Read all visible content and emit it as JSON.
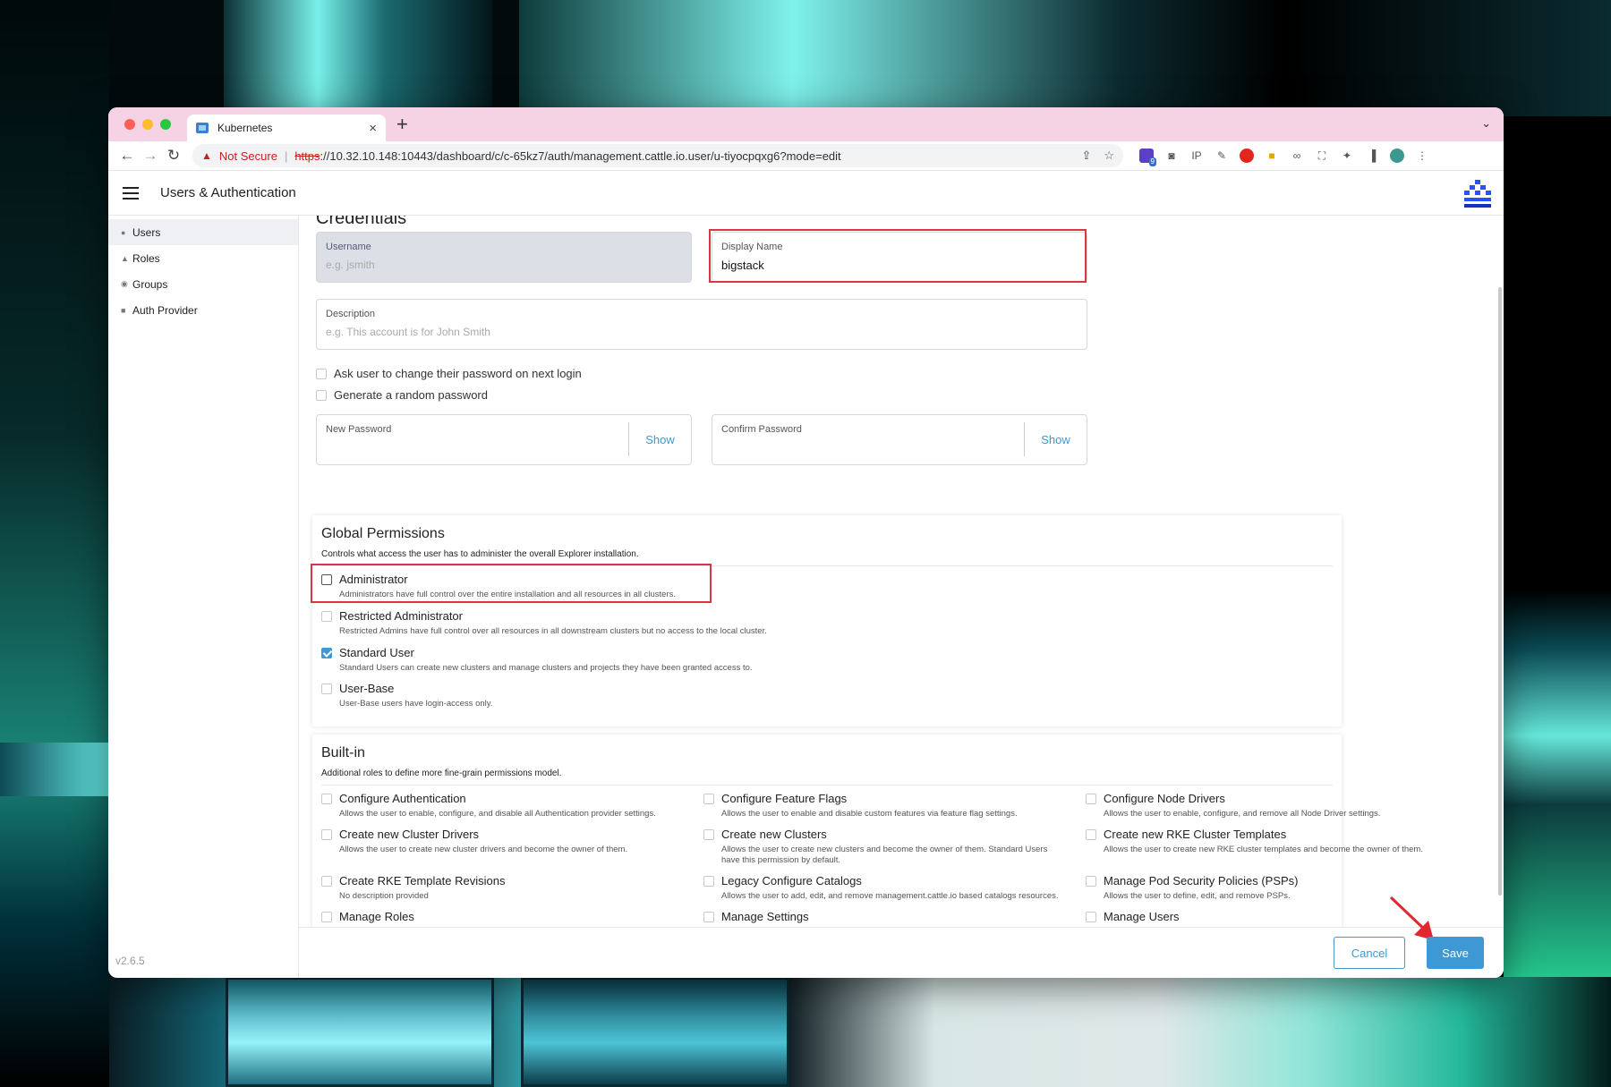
{
  "browser": {
    "tab_title": "Kubernetes",
    "security_label": "Not Secure",
    "url_scheme": "https",
    "url_rest": "://10.32.10.148:10443/dashboard/c/c-65kz7/auth/management.cattle.io.user/u-tiyocpqxg6?mode=edit",
    "extension_badge": "9"
  },
  "app": {
    "title": "Users & Authentication",
    "version": "v2.6.5"
  },
  "sidebar": {
    "items": [
      {
        "label": "Users",
        "icon": "user-icon"
      },
      {
        "label": "Roles",
        "icon": "role-icon"
      },
      {
        "label": "Groups",
        "icon": "group-icon"
      },
      {
        "label": "Auth Provider",
        "icon": "lock-icon"
      }
    ]
  },
  "credentials": {
    "section_title": "Credentials",
    "username_label": "Username",
    "username_placeholder": "e.g. jsmith",
    "display_name_label": "Display Name",
    "display_name_value": "bigstack",
    "description_label": "Description",
    "description_placeholder": "e.g. This account is for John Smith",
    "change_password_label": "Ask user to change their password on next login",
    "random_password_label": "Generate a random password",
    "new_password_label": "New Password",
    "confirm_password_label": "Confirm Password",
    "show_label": "Show"
  },
  "global_permissions": {
    "title": "Global Permissions",
    "description": "Controls what access the user has to administer the overall Explorer installation.",
    "items": [
      {
        "label": "Administrator",
        "desc": "Administrators have full control over the entire installation and all resources in all clusters.",
        "checked": false
      },
      {
        "label": "Restricted Administrator",
        "desc": "Restricted Admins have full control over all resources in all downstream clusters but no access to the local cluster.",
        "checked": false
      },
      {
        "label": "Standard User",
        "desc": "Standard Users can create new clusters and manage clusters and projects they have been granted access to.",
        "checked": true
      },
      {
        "label": "User-Base",
        "desc": "User-Base users have login-access only.",
        "checked": false
      }
    ]
  },
  "builtin": {
    "title": "Built-in",
    "description": "Additional roles to define more fine-grain permissions model.",
    "items": [
      {
        "label": "Configure Authentication",
        "desc": "Allows the user to enable, configure, and disable all Authentication provider settings."
      },
      {
        "label": "Configure Feature Flags",
        "desc": "Allows the user to enable and disable custom features via feature flag settings."
      },
      {
        "label": "Configure Node Drivers",
        "desc": "Allows the user to enable, configure, and remove all Node Driver settings."
      },
      {
        "label": "Create new Cluster Drivers",
        "desc": "Allows the user to create new cluster drivers and become the owner of them."
      },
      {
        "label": "Create new Clusters",
        "desc": "Allows the user to create new clusters and become the owner of them. Standard Users have this permission by default."
      },
      {
        "label": "Create new RKE Cluster Templates",
        "desc": "Allows the user to create new RKE cluster templates and become the owner of them."
      },
      {
        "label": "Create RKE Template Revisions",
        "desc": "No description provided"
      },
      {
        "label": "Legacy Configure Catalogs",
        "desc": "Allows the user to add, edit, and remove management.cattle.io based catalogs resources."
      },
      {
        "label": "Manage Pod Security Policies (PSPs)",
        "desc": "Allows the user to define, edit, and remove PSPs."
      },
      {
        "label": "Manage Roles",
        "desc": ""
      },
      {
        "label": "Manage Settings",
        "desc": ""
      },
      {
        "label": "Manage Users",
        "desc": ""
      }
    ]
  },
  "footer": {
    "cancel_label": "Cancel",
    "save_label": "Save"
  },
  "colors": {
    "accent": "#3d98d3",
    "highlight": "#dc3545",
    "tabbar": "#f6d3e4"
  }
}
